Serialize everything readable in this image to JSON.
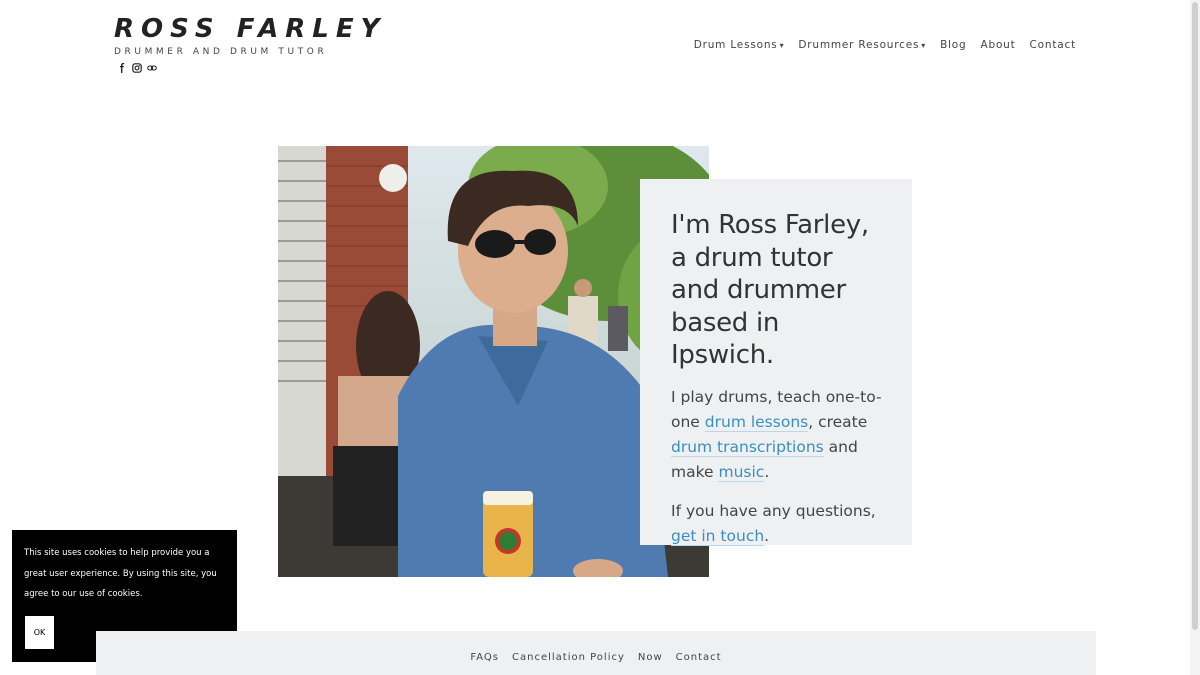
{
  "header": {
    "title": "ROSS FARLEY",
    "tagline": "DRUMMER AND DRUM TUTOR",
    "social_icons": [
      "facebook-icon",
      "instagram-icon",
      "link-icon"
    ]
  },
  "nav": {
    "drum_lessons": "Drum Lessons",
    "drummer_resources": "Drummer Resources",
    "caret": "▾",
    "blog": "Blog",
    "about": "About",
    "contact": "Contact"
  },
  "intro": {
    "heading": "I'm Ross Farley, a drum tutor and drummer based in Ipswich.",
    "p1_a": "I play drums, teach one-to-one ",
    "p1_link1": "drum lessons",
    "p1_b": ", create ",
    "p1_link2": "drum transcriptions",
    "p1_c": " and make ",
    "p1_link3": "music",
    "p1_d": ".",
    "p2_a": "If you have any questions, ",
    "p2_link": "get in touch",
    "p2_b": "."
  },
  "cookie": {
    "text": "This site uses cookies to help provide you a great user experience. By using this site, you agree to our use of cookies.",
    "ok": "OK"
  },
  "footer": {
    "faqs": "FAQs",
    "cancellation": "Cancellation Policy",
    "now": "Now",
    "contact": "Contact"
  },
  "colors": {
    "link": "#3a8fc0",
    "card_bg": "#eff0f1",
    "cookie_bg": "#000000"
  }
}
